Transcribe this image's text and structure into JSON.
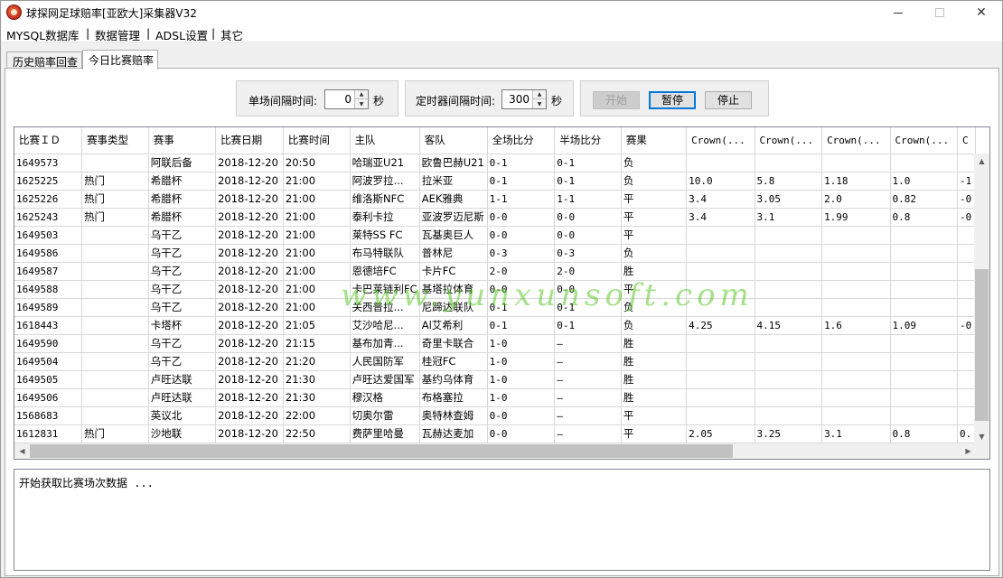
{
  "window": {
    "title": "球探网足球赔率[亚欧大]采集器V32",
    "minimize": "–",
    "close": "✕"
  },
  "menu": [
    "MYSQL数据库",
    "数据管理",
    "ADSL设置",
    "其它"
  ],
  "menu_separator": "|",
  "tabs": [
    "历史赔率回查",
    "今日比赛赔率"
  ],
  "controls": {
    "single_interval_label": "单场间隔时间:",
    "single_interval_value": "0",
    "single_interval_unit": "秒",
    "timer_interval_label": "定时器间隔时间:",
    "timer_interval_value": "300",
    "timer_interval_unit": "秒",
    "start_button": "开始",
    "pause_button": "暂停",
    "stop_button": "停止"
  },
  "table": {
    "columns": [
      "比赛ＩＤ",
      "赛事类型",
      "赛事",
      "比赛日期",
      "比赛时间",
      "主队",
      "客队",
      "全场比分",
      "半场比分",
      "赛果",
      "Crown(...",
      "Crown(...",
      "Crown(...",
      "Crown(...",
      "C"
    ],
    "rows": [
      [
        "1649573",
        "",
        "阿联后备",
        "2018-12-20",
        "20:50",
        "哈瑞亚U21",
        "欧鲁巴赫U21",
        "0-1",
        "0-1",
        "负",
        "",
        "",
        "",
        "",
        ""
      ],
      [
        "1625225",
        "热门",
        "希腊杯",
        "2018-12-20",
        "21:00",
        "阿波罗拉...",
        "拉米亚",
        "0-1",
        "0-1",
        "负",
        "10.0",
        "5.8",
        "1.18",
        "1.0",
        "-1"
      ],
      [
        "1625226",
        "热门",
        "希腊杯",
        "2018-12-20",
        "21:00",
        "维洛斯NFC",
        "AEK雅典",
        "1-1",
        "1-1",
        "平",
        "3.4",
        "3.05",
        "2.0",
        "0.82",
        "-0"
      ],
      [
        "1625243",
        "热门",
        "希腊杯",
        "2018-12-20",
        "21:00",
        "泰利卡拉",
        "亚波罗迈尼斯",
        "0-0",
        "0-0",
        "平",
        "3.4",
        "3.1",
        "1.99",
        "0.8",
        "-0"
      ],
      [
        "1649503",
        "",
        "乌干乙",
        "2018-12-20",
        "21:00",
        "莱特SS FC",
        "瓦基奥巨人",
        "0-0",
        "0-0",
        "平",
        "",
        "",
        "",
        "",
        ""
      ],
      [
        "1649586",
        "",
        "乌干乙",
        "2018-12-20",
        "21:00",
        "布马特联队",
        "普林尼",
        "0-3",
        "0-3",
        "负",
        "",
        "",
        "",
        "",
        ""
      ],
      [
        "1649587",
        "",
        "乌干乙",
        "2018-12-20",
        "21:00",
        "恩德培FC",
        "卡片FC",
        "2-0",
        "2-0",
        "胜",
        "",
        "",
        "",
        "",
        ""
      ],
      [
        "1649588",
        "",
        "乌干乙",
        "2018-12-20",
        "21:00",
        "卡巴莱链利FC",
        "基塔拉体育",
        "0-0",
        "0-0",
        "平",
        "",
        "",
        "",
        "",
        ""
      ],
      [
        "1649589",
        "",
        "乌干乙",
        "2018-12-20",
        "21:00",
        "关西普拉...",
        "尼蹄达联队",
        "0-1",
        "0-1",
        "负",
        "",
        "",
        "",
        "",
        ""
      ],
      [
        "1618443",
        "",
        "卡塔杯",
        "2018-12-20",
        "21:05",
        "艾沙哈尼...",
        "Al艾希利",
        "0-1",
        "0-1",
        "负",
        "4.25",
        "4.15",
        "1.6",
        "1.09",
        "-0"
      ],
      [
        "1649590",
        "",
        "乌干乙",
        "2018-12-20",
        "21:15",
        "基布加青...",
        "奇里卡联合",
        "1-0",
        "–",
        "胜",
        "",
        "",
        "",
        "",
        ""
      ],
      [
        "1649504",
        "",
        "乌干乙",
        "2018-12-20",
        "21:20",
        "人民国防军",
        "桂冠FC",
        "1-0",
        "–",
        "胜",
        "",
        "",
        "",
        "",
        ""
      ],
      [
        "1649505",
        "",
        "卢旺达联",
        "2018-12-20",
        "21:30",
        "卢旺达爱国军",
        "基约乌体育",
        "1-0",
        "–",
        "胜",
        "",
        "",
        "",
        "",
        ""
      ],
      [
        "1649506",
        "",
        "卢旺达联",
        "2018-12-20",
        "21:30",
        "穆汉格",
        "布格塞拉",
        "1-0",
        "–",
        "胜",
        "",
        "",
        "",
        "",
        ""
      ],
      [
        "1568683",
        "",
        "英议北",
        "2018-12-20",
        "22:00",
        "切奥尔雷",
        "奥特林查姆",
        "0-0",
        "–",
        "平",
        "",
        "",
        "",
        "",
        ""
      ],
      [
        "1612831",
        "热门",
        "沙地联",
        "2018-12-20",
        "22:50",
        "费萨里哈曼",
        "瓦赫达麦加",
        "0-0",
        "–",
        "平",
        "2.05",
        "3.25",
        "3.1",
        "0.8",
        "0."
      ]
    ]
  },
  "log": "开始获取比赛场次数据 ...",
  "watermark": "www.yunxunsoft.com"
}
